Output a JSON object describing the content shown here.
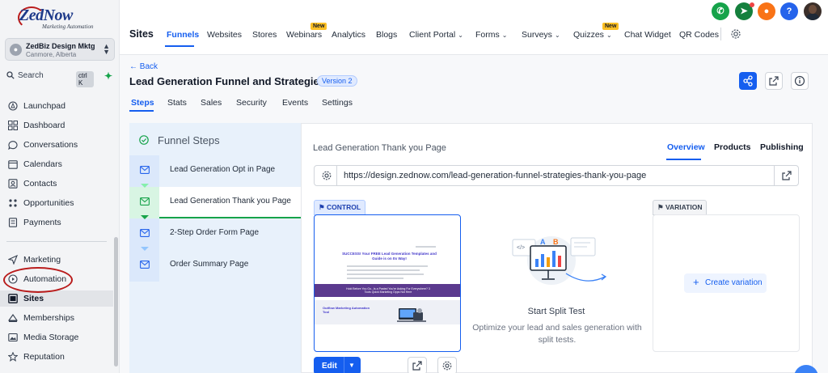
{
  "brand": {
    "logo_text": "ZedNow",
    "logo_tagline": "Marketing Automation"
  },
  "account": {
    "name": "ZedBiz Design Mktg",
    "location": "Canmore, Alberta"
  },
  "search": {
    "label": "Search",
    "shortcut": "ctrl K"
  },
  "sidebar": {
    "items": [
      {
        "label": "Launchpad",
        "icon": "rocket-icon"
      },
      {
        "label": "Dashboard",
        "icon": "grid-icon"
      },
      {
        "label": "Conversations",
        "icon": "chat-icon"
      },
      {
        "label": "Calendars",
        "icon": "calendar-icon"
      },
      {
        "label": "Contacts",
        "icon": "contacts-icon"
      },
      {
        "label": "Opportunities",
        "icon": "opportunities-icon"
      },
      {
        "label": "Payments",
        "icon": "payments-icon"
      },
      {
        "label": "Marketing",
        "icon": "send-icon"
      },
      {
        "label": "Automation",
        "icon": "automation-icon"
      },
      {
        "label": "Sites",
        "icon": "sites-icon",
        "active": true
      },
      {
        "label": "Memberships",
        "icon": "memberships-icon"
      },
      {
        "label": "Media Storage",
        "icon": "image-icon"
      },
      {
        "label": "Reputation",
        "icon": "star-icon"
      }
    ]
  },
  "topnav": {
    "section": "Sites",
    "items": [
      {
        "label": "Funnels",
        "active": true
      },
      {
        "label": "Websites"
      },
      {
        "label": "Stores"
      },
      {
        "label": "Webinars",
        "badge": "New"
      },
      {
        "label": "Analytics"
      },
      {
        "label": "Blogs"
      },
      {
        "label": "Client Portal",
        "dropdown": true
      },
      {
        "label": "Forms",
        "dropdown": true
      },
      {
        "label": "Surveys",
        "dropdown": true
      },
      {
        "label": "Quizzes",
        "dropdown": true,
        "badge": "New"
      },
      {
        "label": "Chat Widget"
      },
      {
        "label": "QR Codes"
      }
    ],
    "header_icons": [
      "phone-icon",
      "megaphone-icon",
      "bell-icon",
      "help-icon",
      "user-avatar"
    ],
    "header_colors": {
      "phone": "#16a34a",
      "megaphone": "#15803d",
      "bell": "#f97316",
      "help": "#2563eb"
    },
    "help_glyph": "?"
  },
  "funnel": {
    "back_label": "← Back",
    "title": "Lead Generation Funnel and Strategies",
    "version": "Version 2",
    "tabs": [
      "Steps",
      "Stats",
      "Sales",
      "Security",
      "Events",
      "Settings"
    ],
    "active_tab": "Steps"
  },
  "steps_panel": {
    "header": "Funnel Steps",
    "steps": [
      {
        "label": "Lead Generation Opt in Page"
      },
      {
        "label": "Lead Generation Thank you Page",
        "selected": true
      },
      {
        "label": "2-Step Order Form Page"
      },
      {
        "label": "Order Summary Page"
      }
    ]
  },
  "detail": {
    "page_name": "Lead Generation Thank you Page",
    "tabs": [
      "Overview",
      "Products",
      "Publishing"
    ],
    "active_tab": "Overview",
    "url": "https://design.zednow.com/lead-generation-funnel-strategies-thank-you-page",
    "control_label": "CONTROL",
    "variation_label": "VARIATION",
    "preview": {
      "headline": "SUCCESS! Your FREE Lead Generation Templates and Guide is on Its Way!",
      "band_text": "Hold Before You Go...Is a Pasted You're Asking For Everywhere? 3 Tools Quick Marketing Opps Not Here",
      "sub_title": "Outflow Marketing Automation Tool"
    },
    "edit_label": "Edit",
    "split_title": "Start Split Test",
    "split_desc": "Optimize your lead and sales generation with split tests.",
    "create_variation": "Create variation",
    "accent_color": "#155eef"
  }
}
